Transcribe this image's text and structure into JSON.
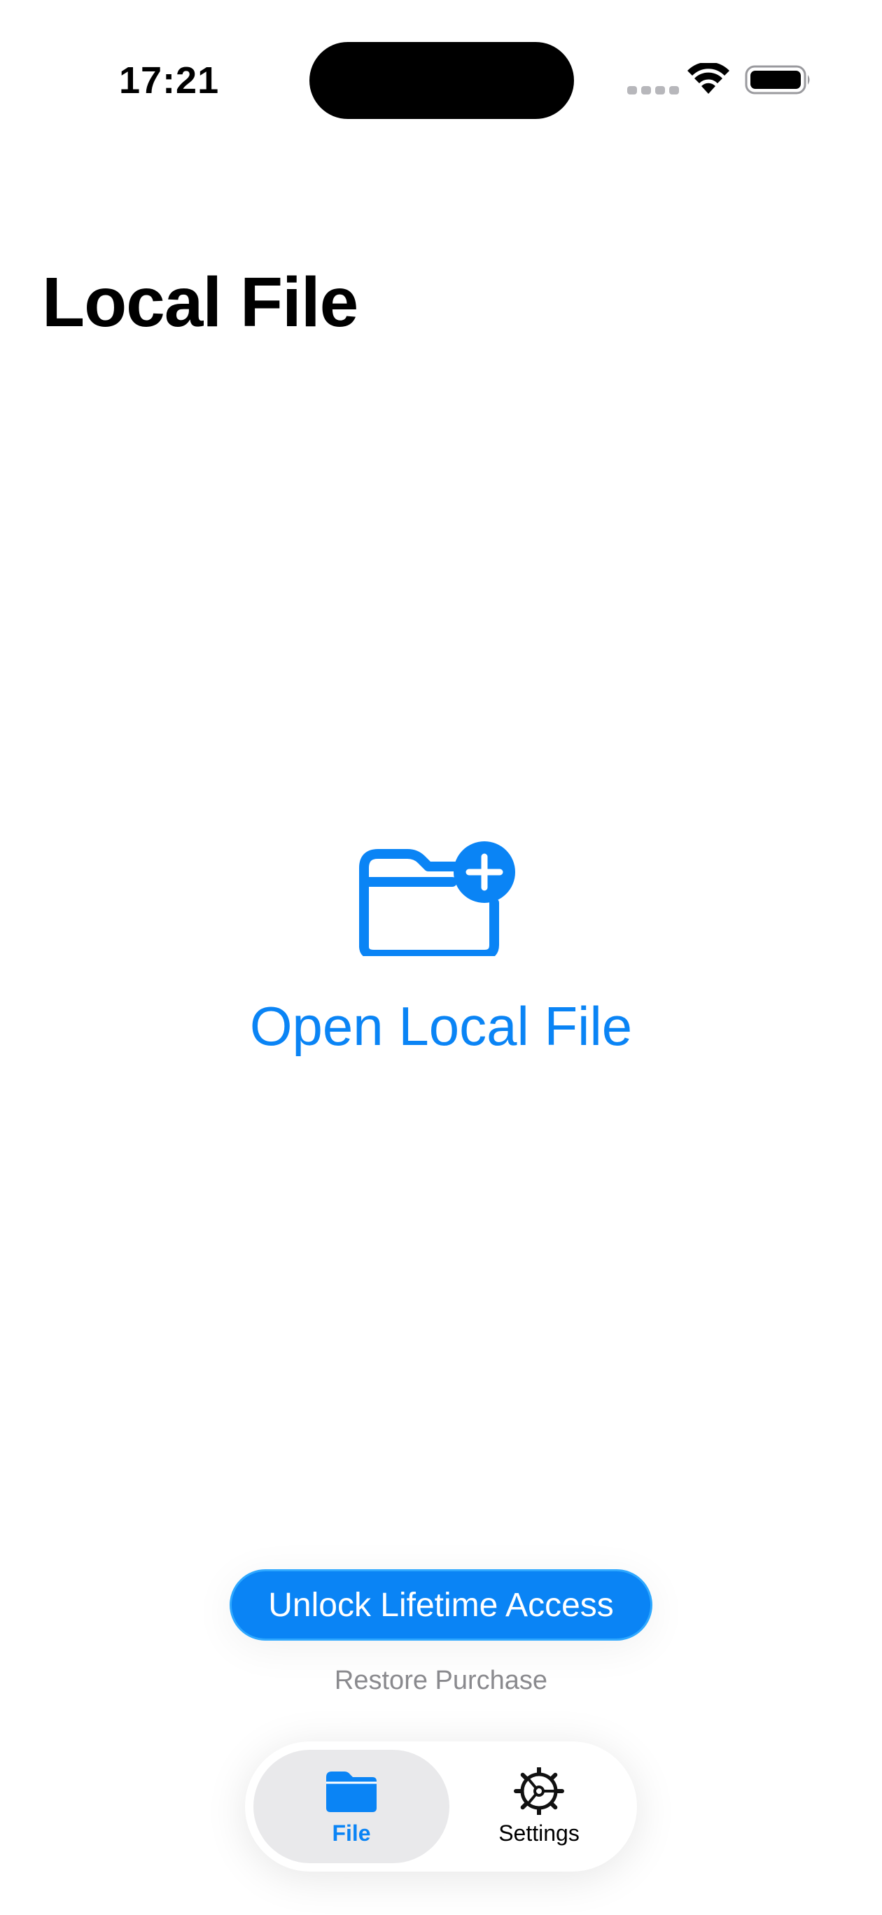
{
  "status_bar": {
    "time": "17:21"
  },
  "page": {
    "title": "Local File"
  },
  "main": {
    "open_file_label": "Open Local File",
    "icon": "folder-plus-icon"
  },
  "purchase": {
    "unlock_label": "Unlock Lifetime Access",
    "restore_label": "Restore Purchase"
  },
  "tab_bar": {
    "tabs": [
      {
        "label": "File",
        "icon": "folder-icon",
        "selected": true
      },
      {
        "label": "Settings",
        "icon": "gear-icon",
        "selected": false
      }
    ]
  },
  "colors": {
    "accent": "#0a84f5",
    "secondary_text": "#8a8a8e",
    "tab_selected_bg": "#e9e9eb"
  }
}
